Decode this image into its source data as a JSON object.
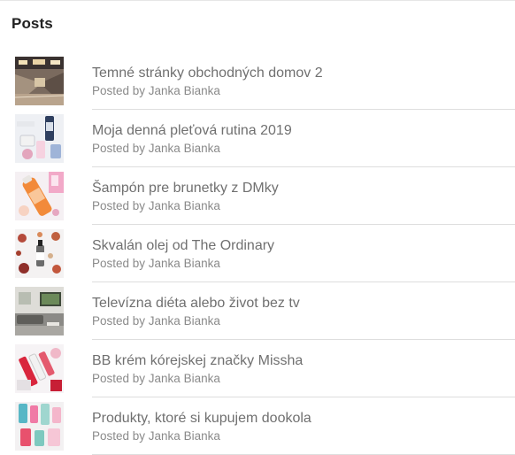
{
  "widget": {
    "title": "Posts"
  },
  "byline_prefix": "Posted by",
  "posts": [
    {
      "title": "Temné stránky obchodných domov 2",
      "byline": "Posted by Janka Bianka",
      "thumbnail": "mall-interior-image"
    },
    {
      "title": "Moja denná pleťová rutina 2019",
      "byline": "Posted by Janka Bianka",
      "thumbnail": "skincare-products-image"
    },
    {
      "title": "Šampón pre brunetky z DMky",
      "byline": "Posted by Janka Bianka",
      "thumbnail": "shampoo-bottle-image"
    },
    {
      "title": "Skvalán olej od The Ordinary",
      "byline": "Posted by Janka Bianka",
      "thumbnail": "oil-and-flowers-image"
    },
    {
      "title": "Televízna diéta alebo život bez tv",
      "byline": "Posted by Janka Bianka",
      "thumbnail": "living-room-tv-image"
    },
    {
      "title": "BB krém kórejskej značky Missha",
      "byline": "Posted by Janka Bianka",
      "thumbnail": "bb-cream-products-image"
    },
    {
      "title": "Produkty, ktoré si kupujem dookola",
      "byline": "Posted by Janka Bianka",
      "thumbnail": "cosmetics-flatlay-image"
    }
  ]
}
